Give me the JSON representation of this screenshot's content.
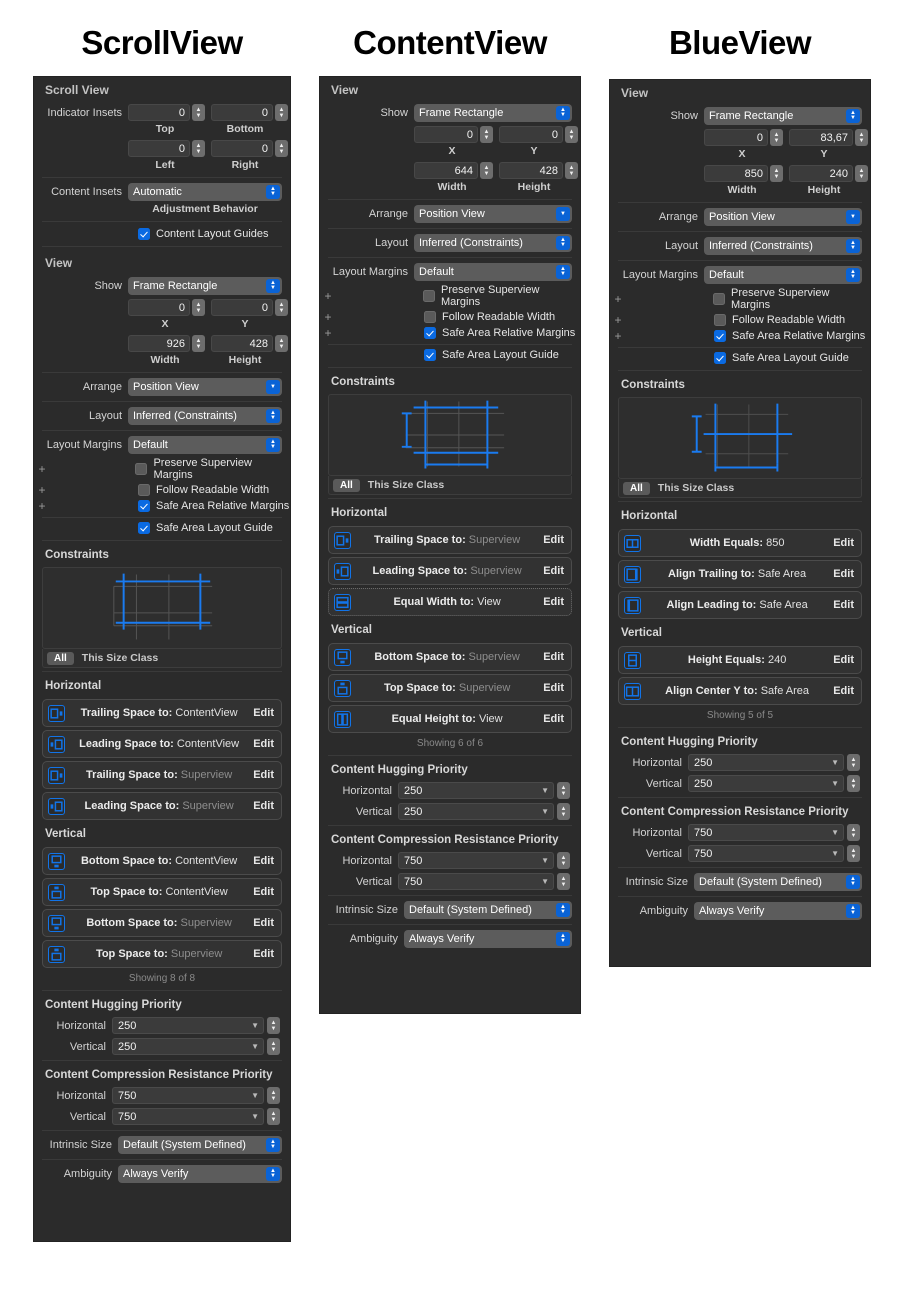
{
  "columns": [
    {
      "title": "ScrollView",
      "sections": {
        "scroll_view_header": "Scroll View",
        "indicator_insets_label": "Indicator Insets",
        "insets": {
          "top": {
            "value": "0",
            "caption": "Top"
          },
          "bottom": {
            "value": "0",
            "caption": "Bottom"
          },
          "left": {
            "value": "0",
            "caption": "Left"
          },
          "right": {
            "value": "0",
            "caption": "Right"
          }
        },
        "content_insets_label": "Content Insets",
        "content_insets_value": "Automatic",
        "adjustment_behavior_caption": "Adjustment Behavior",
        "content_layout_guides": {
          "label": "Content Layout Guides",
          "checked": true
        },
        "view_header": "View",
        "show_label": "Show",
        "show_value": "Frame Rectangle",
        "frame": {
          "x": {
            "value": "0",
            "caption": "X"
          },
          "y": {
            "value": "0",
            "caption": "Y"
          },
          "width": {
            "value": "926",
            "caption": "Width"
          },
          "height": {
            "value": "428",
            "caption": "Height"
          }
        },
        "arrange_label": "Arrange",
        "arrange_value": "Position View",
        "layout_label": "Layout",
        "layout_value": "Inferred (Constraints)",
        "layout_margins_label": "Layout Margins",
        "layout_margins_value": "Default",
        "margin_checks": [
          {
            "label": "Preserve Superview Margins",
            "checked": false,
            "plus": true
          },
          {
            "label": "Follow Readable Width",
            "checked": false,
            "plus": true
          },
          {
            "label": "Safe Area Relative Margins",
            "checked": true,
            "plus": true
          },
          {
            "label": "Safe Area Layout Guide",
            "checked": true,
            "plus": false
          }
        ],
        "constraints_header": "Constraints",
        "size_class_all": "All",
        "size_class_text": "This Size Class",
        "horizontal_header": "Horizontal",
        "horizontal_items": [
          {
            "icon": "trailing-space-icon",
            "label": "Trailing Space to:",
            "value": "ContentView",
            "dim": false,
            "edit": "Edit",
            "dotted": false
          },
          {
            "icon": "leading-space-icon",
            "label": "Leading Space to:",
            "value": "ContentView",
            "dim": false,
            "edit": "Edit",
            "dotted": false
          },
          {
            "icon": "trailing-space-icon",
            "label": "Trailing Space to:",
            "value": "Superview",
            "dim": true,
            "edit": "Edit",
            "dotted": false
          },
          {
            "icon": "leading-space-icon",
            "label": "Leading Space to:",
            "value": "Superview",
            "dim": true,
            "edit": "Edit",
            "dotted": false
          }
        ],
        "vertical_header": "Vertical",
        "vertical_items": [
          {
            "icon": "bottom-space-icon",
            "label": "Bottom Space to:",
            "value": "ContentView",
            "dim": false,
            "edit": "Edit",
            "dotted": false
          },
          {
            "icon": "top-space-icon",
            "label": "Top Space to:",
            "value": "ContentView",
            "dim": false,
            "edit": "Edit",
            "dotted": false
          },
          {
            "icon": "bottom-space-icon",
            "label": "Bottom Space to:",
            "value": "Superview",
            "dim": true,
            "edit": "Edit",
            "dotted": false
          },
          {
            "icon": "top-space-icon",
            "label": "Top Space to:",
            "value": "Superview",
            "dim": true,
            "edit": "Edit",
            "dotted": false
          }
        ],
        "showing": "Showing 8 of 8",
        "hugging_header": "Content Hugging Priority",
        "hugging": {
          "h_label": "Horizontal",
          "h_value": "250",
          "v_label": "Vertical",
          "v_value": "250"
        },
        "compression_header": "Content Compression Resistance Priority",
        "compression": {
          "h_label": "Horizontal",
          "h_value": "750",
          "v_label": "Vertical",
          "v_value": "750"
        },
        "intrinsic_label": "Intrinsic Size",
        "intrinsic_value": "Default (System Defined)",
        "ambiguity_label": "Ambiguity",
        "ambiguity_value": "Always Verify"
      }
    },
    {
      "title": "ContentView",
      "sections": {
        "view_header": "View",
        "show_label": "Show",
        "show_value": "Frame Rectangle",
        "frame": {
          "x": {
            "value": "0",
            "caption": "X"
          },
          "y": {
            "value": "0",
            "caption": "Y"
          },
          "width": {
            "value": "644",
            "caption": "Width"
          },
          "height": {
            "value": "428",
            "caption": "Height"
          }
        },
        "arrange_label": "Arrange",
        "arrange_value": "Position View",
        "layout_label": "Layout",
        "layout_value": "Inferred (Constraints)",
        "layout_margins_label": "Layout Margins",
        "layout_margins_value": "Default",
        "margin_checks": [
          {
            "label": "Preserve Superview Margins",
            "checked": false,
            "plus": true
          },
          {
            "label": "Follow Readable Width",
            "checked": false,
            "plus": true
          },
          {
            "label": "Safe Area Relative Margins",
            "checked": true,
            "plus": true
          },
          {
            "label": "Safe Area Layout Guide",
            "checked": true,
            "plus": false
          }
        ],
        "constraints_header": "Constraints",
        "size_class_all": "All",
        "size_class_text": "This Size Class",
        "horizontal_header": "Horizontal",
        "horizontal_items": [
          {
            "icon": "trailing-space-icon",
            "label": "Trailing Space to:",
            "value": "Superview",
            "dim": true,
            "edit": "Edit",
            "dotted": false
          },
          {
            "icon": "leading-space-icon",
            "label": "Leading Space to:",
            "value": "Superview",
            "dim": true,
            "edit": "Edit",
            "dotted": false
          },
          {
            "icon": "equal-width-icon",
            "label": "Equal Width to:",
            "value": "View",
            "dim": false,
            "edit": "Edit",
            "dotted": true
          }
        ],
        "vertical_header": "Vertical",
        "vertical_items": [
          {
            "icon": "bottom-space-icon",
            "label": "Bottom Space to:",
            "value": "Superview",
            "dim": true,
            "edit": "Edit",
            "dotted": false
          },
          {
            "icon": "top-space-icon",
            "label": "Top Space to:",
            "value": "Superview",
            "dim": true,
            "edit": "Edit",
            "dotted": false
          },
          {
            "icon": "equal-height-icon",
            "label": "Equal Height to:",
            "value": "View",
            "dim": false,
            "edit": "Edit",
            "dotted": false
          }
        ],
        "showing": "Showing 6 of 6",
        "hugging_header": "Content Hugging Priority",
        "hugging": {
          "h_label": "Horizontal",
          "h_value": "250",
          "v_label": "Vertical",
          "v_value": "250"
        },
        "compression_header": "Content Compression Resistance Priority",
        "compression": {
          "h_label": "Horizontal",
          "h_value": "750",
          "v_label": "Vertical",
          "v_value": "750"
        },
        "intrinsic_label": "Intrinsic Size",
        "intrinsic_value": "Default (System Defined)",
        "ambiguity_label": "Ambiguity",
        "ambiguity_value": "Always Verify"
      }
    },
    {
      "title": "BlueView",
      "sections": {
        "view_header": "View",
        "show_label": "Show",
        "show_value": "Frame Rectangle",
        "frame": {
          "x": {
            "value": "0",
            "caption": "X"
          },
          "y": {
            "value": "83,67",
            "caption": "Y"
          },
          "width": {
            "value": "850",
            "caption": "Width"
          },
          "height": {
            "value": "240",
            "caption": "Height"
          }
        },
        "arrange_label": "Arrange",
        "arrange_value": "Position View",
        "layout_label": "Layout",
        "layout_value": "Inferred (Constraints)",
        "layout_margins_label": "Layout Margins",
        "layout_margins_value": "Default",
        "margin_checks": [
          {
            "label": "Preserve Superview Margins",
            "checked": false,
            "plus": true
          },
          {
            "label": "Follow Readable Width",
            "checked": false,
            "plus": true
          },
          {
            "label": "Safe Area Relative Margins",
            "checked": true,
            "plus": true
          },
          {
            "label": "Safe Area Layout Guide",
            "checked": true,
            "plus": false
          }
        ],
        "constraints_header": "Constraints",
        "size_class_all": "All",
        "size_class_text": "This Size Class",
        "horizontal_header": "Horizontal",
        "horizontal_items": [
          {
            "icon": "width-equals-icon",
            "label": "Width Equals:",
            "value": "850",
            "dim": false,
            "edit": "Edit",
            "dotted": false
          },
          {
            "icon": "align-trailing-icon",
            "label": "Align Trailing to:",
            "value": "Safe Area",
            "dim": false,
            "edit": "Edit",
            "dotted": false
          },
          {
            "icon": "align-leading-icon",
            "label": "Align Leading to:",
            "value": "Safe Area",
            "dim": false,
            "edit": "Edit",
            "dotted": false
          }
        ],
        "vertical_header": "Vertical",
        "vertical_items": [
          {
            "icon": "height-equals-icon",
            "label": "Height Equals:",
            "value": "240",
            "dim": false,
            "edit": "Edit",
            "dotted": false
          },
          {
            "icon": "align-center-y-icon",
            "label": "Align Center Y to:",
            "value": "Safe Area",
            "dim": false,
            "edit": "Edit",
            "dotted": false
          }
        ],
        "showing": "Showing 5 of 5",
        "hugging_header": "Content Hugging Priority",
        "hugging": {
          "h_label": "Horizontal",
          "h_value": "250",
          "v_label": "Vertical",
          "v_value": "250"
        },
        "compression_header": "Content Compression Resistance Priority",
        "compression": {
          "h_label": "Horizontal",
          "h_value": "750",
          "v_label": "Vertical",
          "v_value": "750"
        },
        "intrinsic_label": "Intrinsic Size",
        "intrinsic_value": "Default (System Defined)",
        "ambiguity_label": "Ambiguity",
        "ambiguity_value": "Always Verify"
      }
    }
  ],
  "colors": {
    "panel_bg": "#2b2b2b",
    "accent_blue": "#0a6ae2",
    "constraint_blue": "#1274e8",
    "field_bg": "#3b3b3b",
    "popup_bg": "#5c5c5c",
    "page_bg": "#ffffff"
  }
}
